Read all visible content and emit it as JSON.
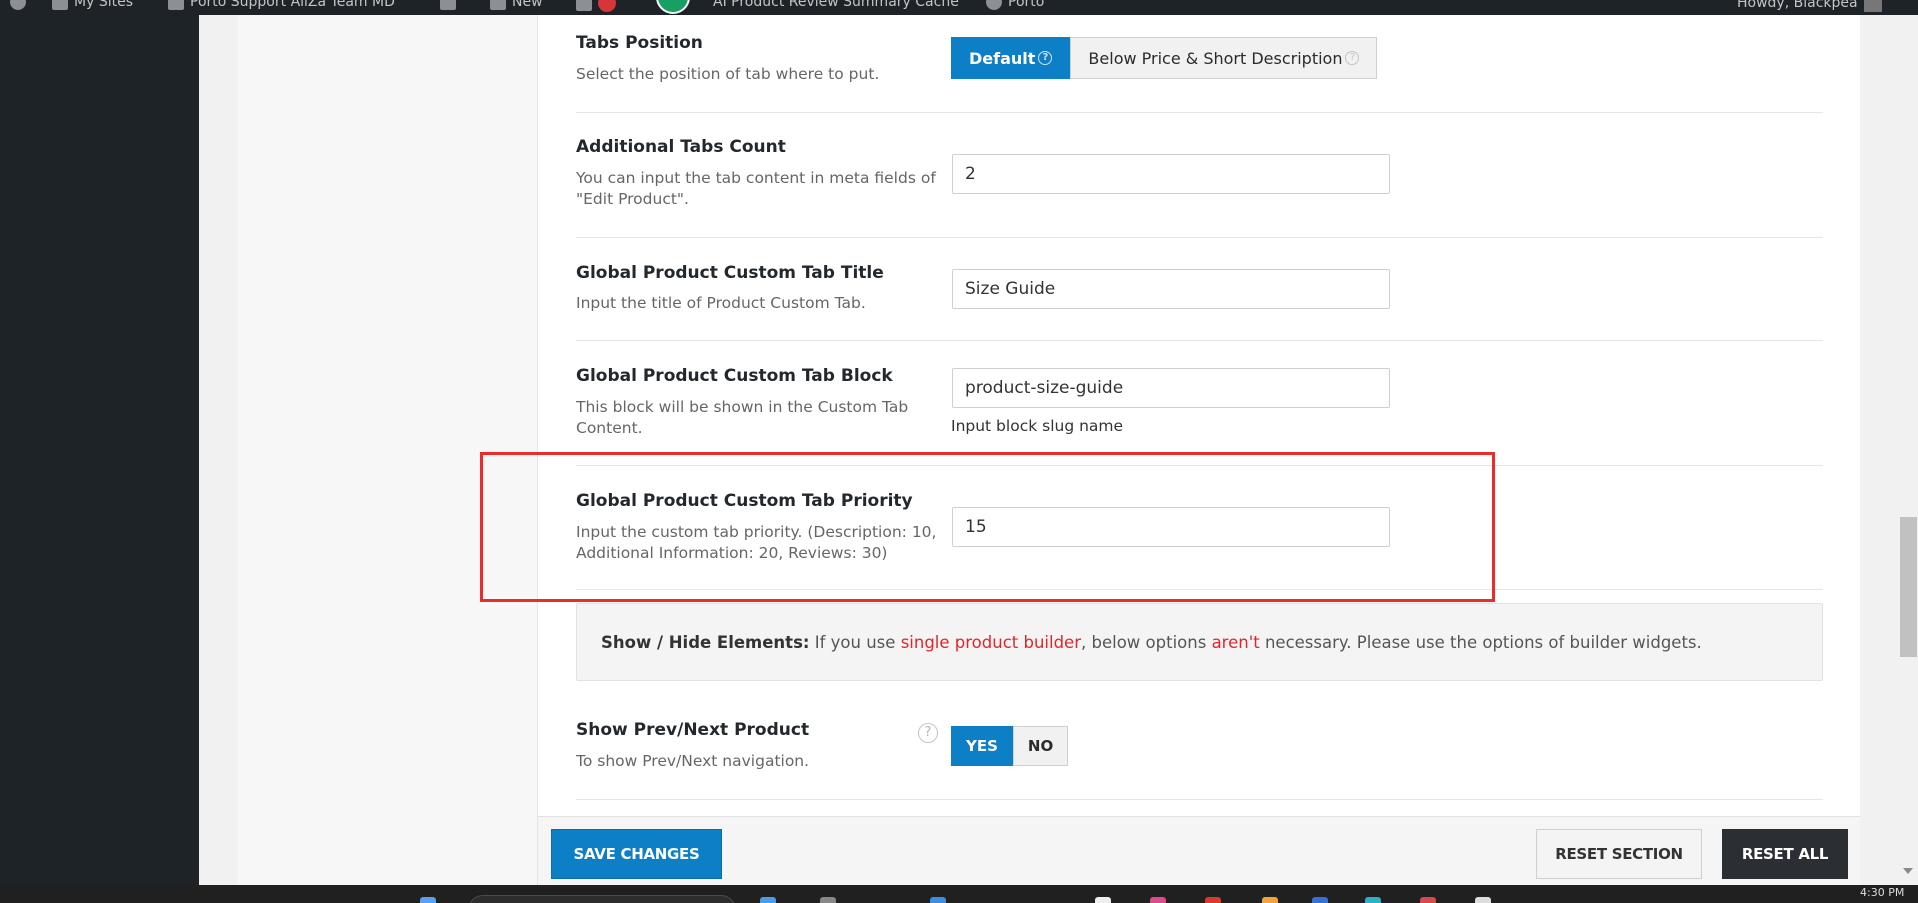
{
  "admin_bar": {
    "my_sites": "My Sites",
    "site_name": "Porto Support AliZa Team MD",
    "new_label": "New",
    "cache_item": "AI Product Review Summary Cache",
    "theme_item": "Porto",
    "howdy": "Howdy, Blackpea"
  },
  "fields": {
    "tabs_position": {
      "title": "Tabs Position",
      "desc": "Select the position of tab where to put.",
      "options": [
        {
          "label": "Default",
          "active": true
        },
        {
          "label": "Below Price & Short Description",
          "active": false
        }
      ]
    },
    "additional_tabs_count": {
      "title": "Additional Tabs Count",
      "desc": "You can input the tab content in meta fields of \"Edit Product\".",
      "value": "2"
    },
    "custom_tab_title": {
      "title": "Global Product Custom Tab Title",
      "desc": "Input the title of Product Custom Tab.",
      "value": "Size Guide"
    },
    "custom_tab_block": {
      "title": "Global Product Custom Tab Block",
      "desc": "This block will be shown in the Custom Tab Content.",
      "value": "product-size-guide",
      "hint": "Input block slug name"
    },
    "custom_tab_priority": {
      "title": "Global Product Custom Tab Priority",
      "desc": "Input the custom tab priority. (Description: 10, Additional Information: 20, Reviews: 30)",
      "value": "15"
    }
  },
  "info_box": {
    "heading": "Show / Hide Elements:",
    "text_1": " If you use ",
    "link_1": "single product builder",
    "text_2": ", below options ",
    "link_2": "aren't",
    "text_3": " necessary. Please use the options of builder widgets."
  },
  "prev_next": {
    "title": "Show Prev/Next Product",
    "desc": "To show Prev/Next navigation.",
    "yes": "YES",
    "no": "NO",
    "help": "?"
  },
  "help_glyph": "?",
  "footer": {
    "save": "SAVE CHANGES",
    "reset_section": "RESET SECTION",
    "reset_all": "RESET ALL"
  },
  "taskbar": {
    "clock": "4:30 PM"
  },
  "colors": {
    "accent": "#0c7fc6",
    "highlight": "#ec2b2b",
    "warning_text": "#e0262b",
    "admin_dark": "#1d2327"
  }
}
